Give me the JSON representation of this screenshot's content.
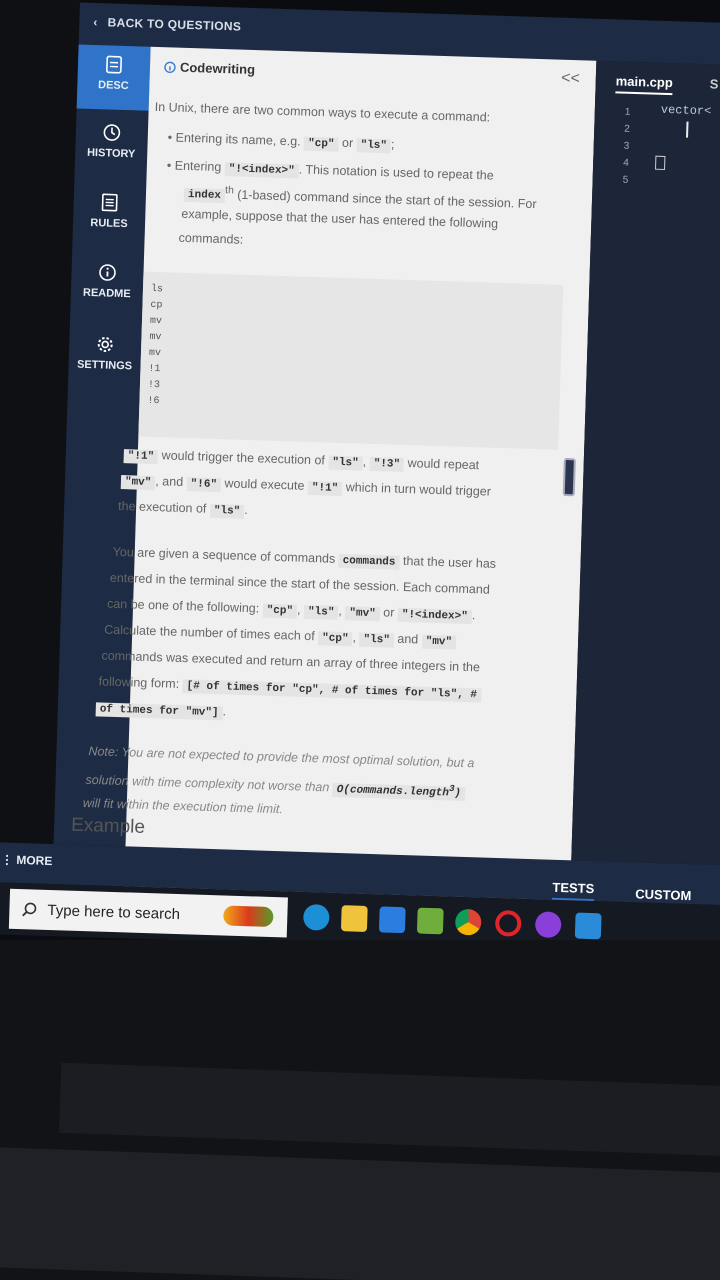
{
  "header": {
    "back_label": "BACK TO QUESTIONS"
  },
  "sidebar": {
    "items": [
      {
        "label": "DESC",
        "icon": "document-icon",
        "active": true
      },
      {
        "label": "HISTORY",
        "icon": "clock-icon"
      },
      {
        "label": "RULES",
        "icon": "list-icon"
      },
      {
        "label": "README",
        "icon": "info-icon"
      },
      {
        "label": "SETTINGS",
        "icon": "gear-icon"
      }
    ],
    "more_label": "MORE"
  },
  "panel": {
    "title": "Codewriting",
    "collapse_glyph": "<<",
    "intro": "In Unix, there are two common ways to execute a command:",
    "bullet1_text": "Entering its name, e.g.",
    "bullet1_code_a": "\"cp\"",
    "bullet1_or": "or",
    "bullet1_code_b": "\"ls\"",
    "bullet1_end": ";",
    "bullet2_text": "Entering",
    "bullet2_code": "\"!<index>\"",
    "bullet2_rest": ". This notation is used to repeat the",
    "bullet2_index_word": "index",
    "bullet2_sup": "th",
    "bullet2_line2": "(1-based) command since the start of the session. For",
    "bullet2_line3": "example, suppose that the user has entered the following",
    "bullet2_line4": "commands:",
    "command_lines": [
      "ls",
      "cp",
      "mv",
      "mv",
      "mv",
      "!1",
      "!3",
      "!6"
    ],
    "explain": {
      "c1": "\"!1\"",
      "t1": "would trigger the execution of",
      "c2": "\"ls\"",
      "t2": ",",
      "c3": "\"!3\"",
      "t3": "would repeat",
      "c4": "\"mv\"",
      "t4": ", and",
      "c5": "\"!6\"",
      "t5": "would execute",
      "c6": "\"!1\"",
      "t6": "which in turn would trigger",
      "t7": "the execution of",
      "c7": "\"ls\"",
      "t8": "."
    },
    "given": {
      "l1a": "You are given a sequence of commands",
      "l1code": "commands",
      "l1b": "that the user has",
      "l2": "entered in the terminal since the start of the session. Each command",
      "l3a": "can be one of the following:",
      "l3c1": "\"cp\"",
      "l3c2": "\"ls\"",
      "l3c3": "\"mv\"",
      "l3or": "or",
      "l3c4": "\"!<index>\"",
      "l3end": ".",
      "l4a": "Calculate the number of times each of",
      "l4c1": "\"cp\"",
      "l4c2": "\"ls\"",
      "l4and": "and",
      "l4c3": "\"mv\"",
      "l5": "commands was executed and return an array of three integers in the",
      "l6a": "following form:",
      "l6code": "[# of times for \"cp\", # of times for \"ls\", #",
      "l7code": "of times for \"mv\"]",
      "l7end": "."
    },
    "note": {
      "l1": "Note: You are not expected to provide the most optimal solution, but a",
      "l2a": "solution with time complexity not worse than",
      "l2code": "O(commands.length",
      "l2sup": "3",
      "l2close": ")",
      "l3": "will fit within the execution time limit."
    },
    "example_heading": "Example"
  },
  "editor": {
    "file_tab": "main.cpp",
    "second_tab": "S",
    "line_numbers": [
      "1",
      "2",
      "3",
      "4",
      "5"
    ],
    "code_line1": "vector<"
  },
  "bottom": {
    "tests_label": "TESTS",
    "custom_label": "CUSTOM"
  },
  "taskbar": {
    "search_placeholder": "Type here to search"
  }
}
